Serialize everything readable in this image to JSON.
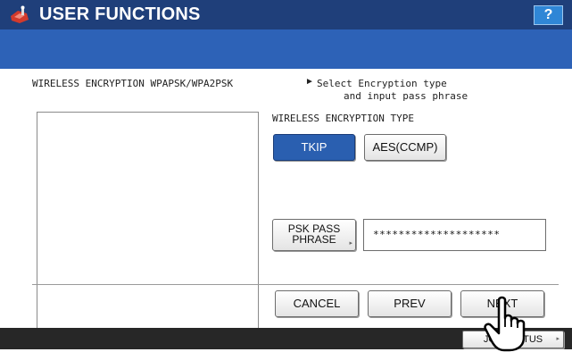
{
  "header": {
    "title": "USER FUNCTIONS",
    "help_label": "?",
    "icon": "user-functions-icon"
  },
  "panel": {
    "heading": "WIRELESS ENCRYPTION WPAPSK/WPA2PSK",
    "hint_arrow": "►",
    "hint_line1": "Select Encryption type",
    "hint_line2": "and input pass phrase"
  },
  "encryption": {
    "label": "WIRELESS ENCRYPTION TYPE",
    "options": [
      "TKIP",
      "AES(CCMP)"
    ],
    "selected": "TKIP"
  },
  "psk": {
    "button_label_line1": "PSK PASS",
    "button_label_line2": "PHRASE",
    "value": "********************"
  },
  "actions": {
    "cancel": "CANCEL",
    "prev": "PREV",
    "next": "NEXT"
  },
  "footer": {
    "job_status": "JOB STATUS"
  },
  "colors": {
    "titlebar": "#1f3f7a",
    "subbar": "#2d62b7",
    "selected_button": "#2a5fb0",
    "help_button": "#2f86d6",
    "footer": "#272727"
  }
}
